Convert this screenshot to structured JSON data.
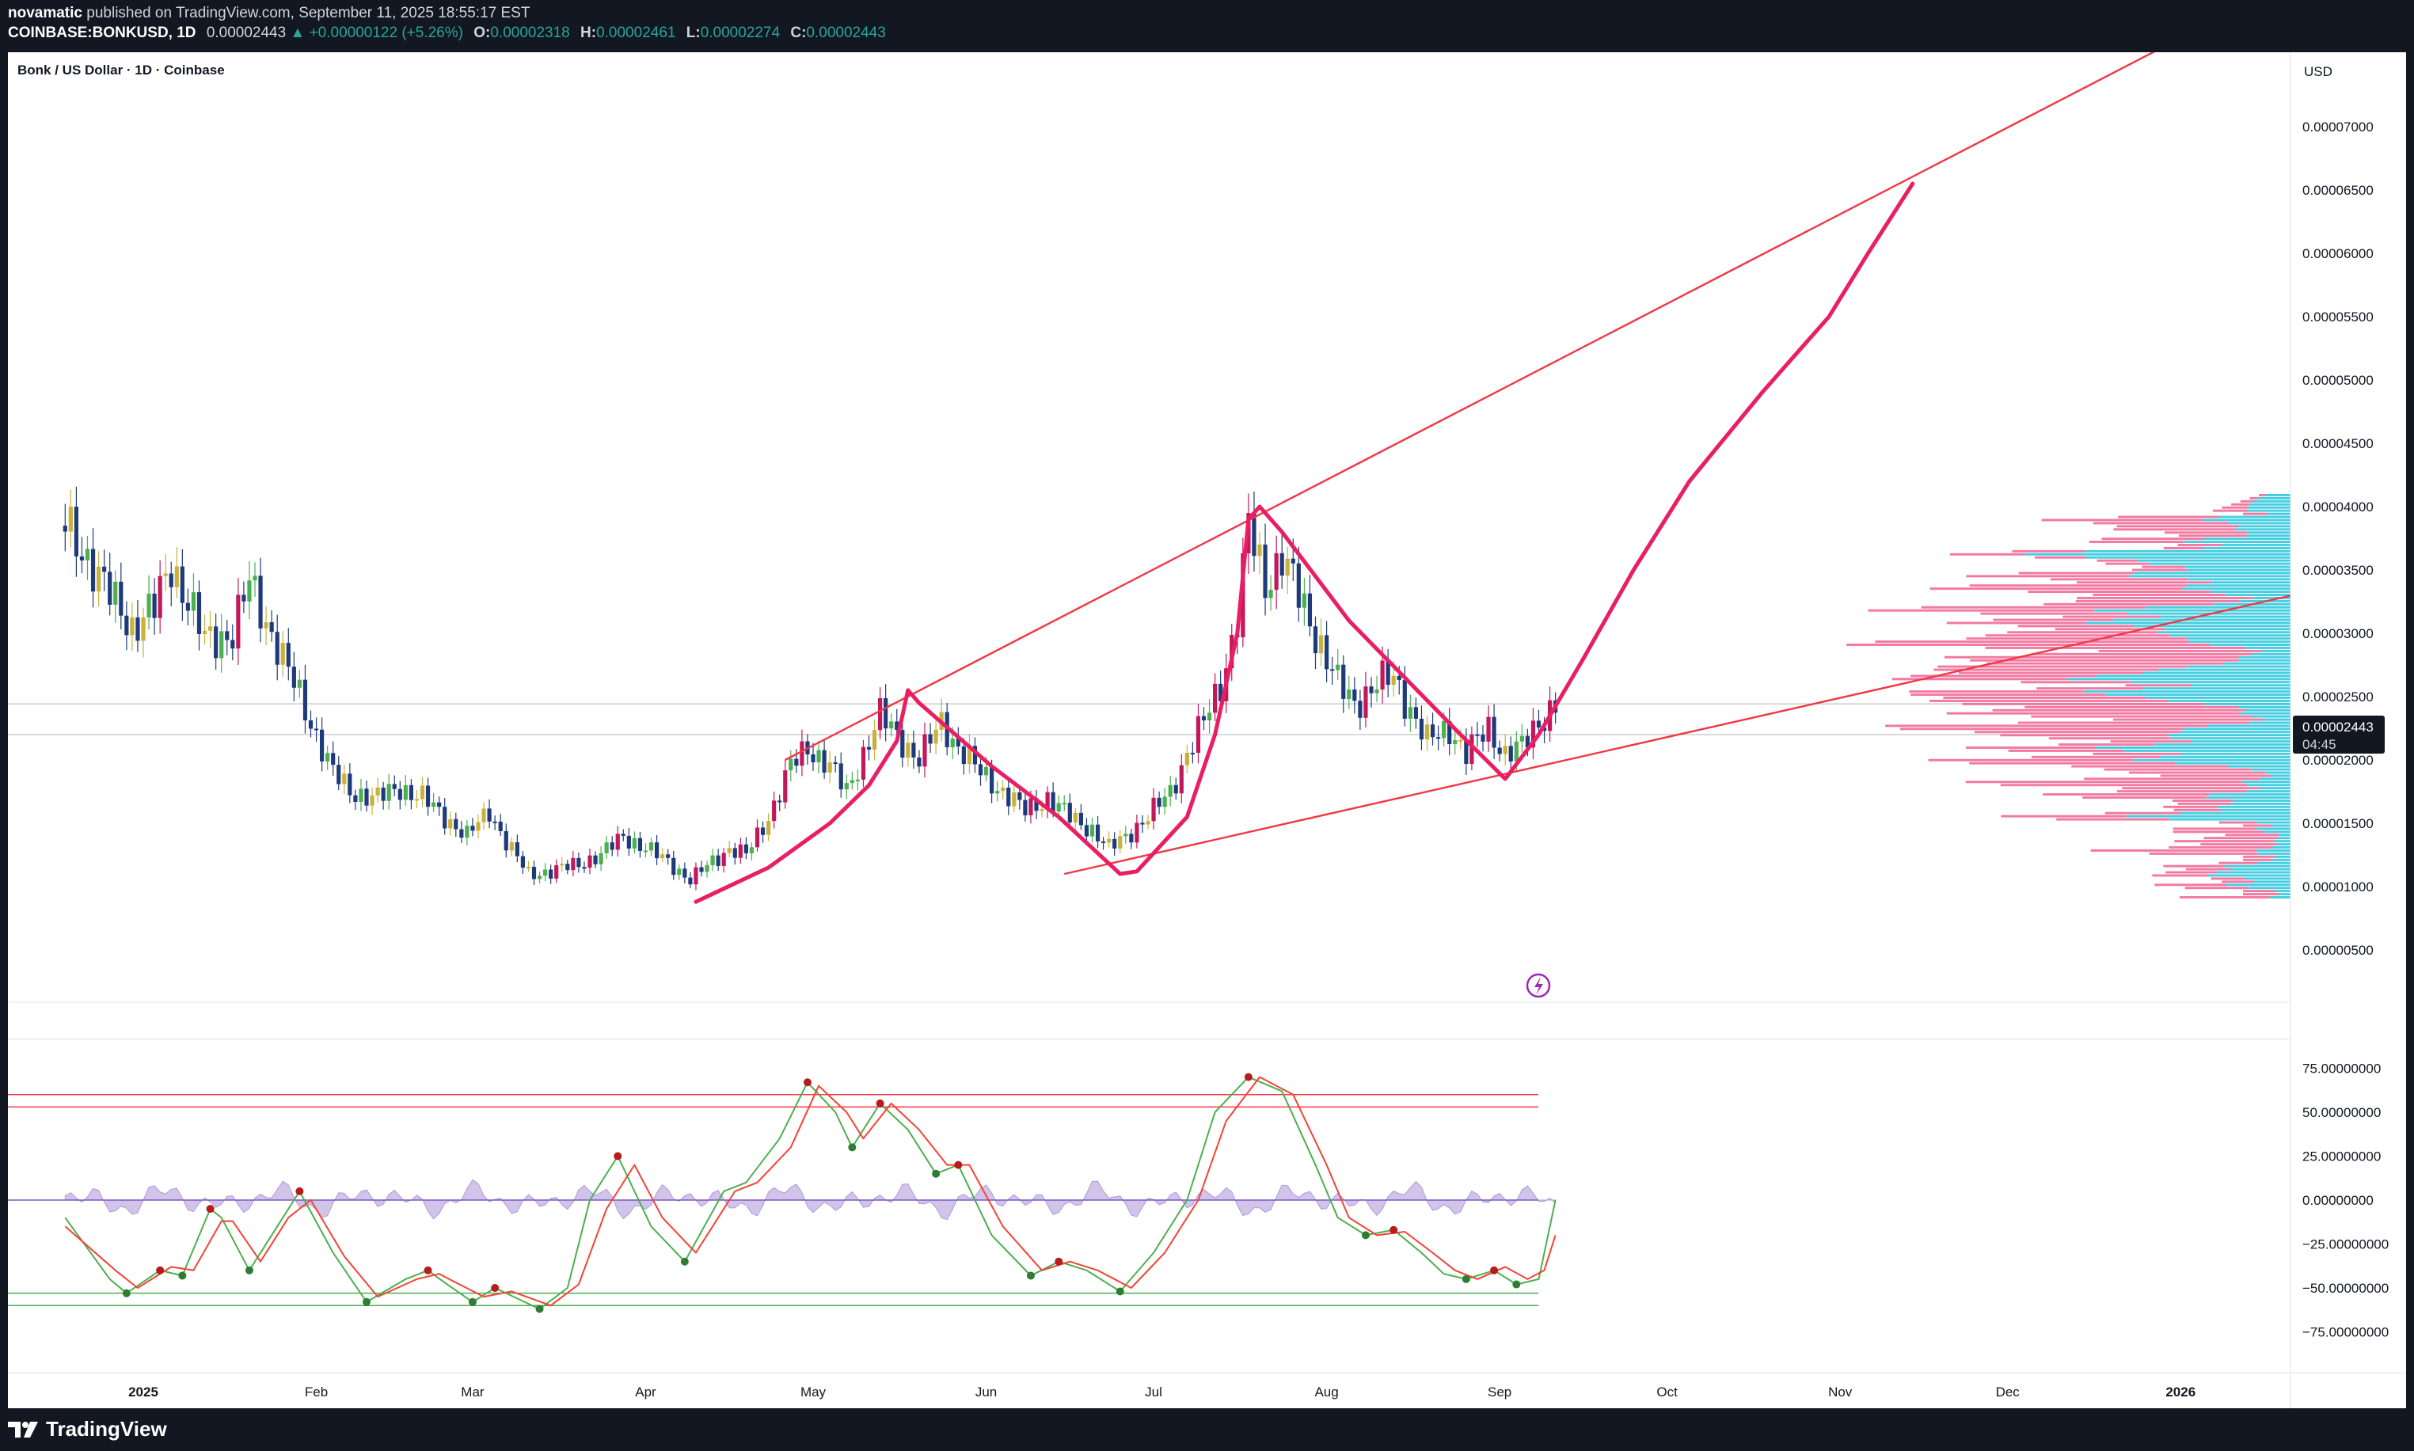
{
  "header": {
    "publisher": "novamatic",
    "published_text": "published on TradingView.com, September 11, 2025 18:55:17 EST",
    "symbol": "COINBASE:BONKUSD, 1D",
    "last": "0.00002443",
    "change": "▲ +0.00000122 (+5.26%)",
    "o_label": "O:",
    "o": "0.00002318",
    "h_label": "H:",
    "h": "0.00002461",
    "l_label": "L:",
    "l": "0.00002274",
    "c_label": "C:",
    "c": "0.00002443"
  },
  "chart": {
    "title": "Bonk / US Dollar · 1D · Coinbase",
    "currency": "USD",
    "price_tag": "0.00002443",
    "countdown": "04:45"
  },
  "colors": {
    "bull": "#4caf50",
    "bear": "#1e3a7b",
    "neutral": "#c9b13a",
    "hot": "#c2185b",
    "drawing": "#e91e63",
    "trendline": "#f23645",
    "vp_up": "#26c6da",
    "vp_down": "#f06292",
    "osc_fast": "#4caf50",
    "osc_slow": "#f44336",
    "histogram": "#b39ddb"
  },
  "footer": {
    "logo_text": "TradingView"
  },
  "chart_data": [
    {
      "type": "candlestick",
      "title": "Bonk / US Dollar · 1D · Coinbase",
      "y_unit": "USD",
      "x_ticks": [
        "2025",
        "Feb",
        "Mar",
        "Apr",
        "May",
        "Jun",
        "Jul",
        "Aug",
        "Sep",
        "Oct",
        "Nov",
        "Dec",
        "2026"
      ],
      "y_ticks": [
        "0.00007000",
        "0.00006500",
        "0.00006000",
        "0.00005500",
        "0.00005000",
        "0.00004500",
        "0.00004000",
        "0.00003500",
        "0.00003000",
        "0.00002500",
        "0.00002000",
        "0.00001500",
        "0.00001000",
        "0.00000500"
      ],
      "last_price": "0.00002443",
      "price_path": [
        {
          "date": "2024-12-18",
          "close": 3.85e-05
        },
        {
          "date": "2024-12-22",
          "close": 3.6e-05
        },
        {
          "date": "2024-12-26",
          "close": 3.3e-05
        },
        {
          "date": "2024-12-30",
          "close": 3.05e-05
        },
        {
          "date": "2025-01-03",
          "close": 3.2e-05
        },
        {
          "date": "2025-01-06",
          "close": 3.55e-05
        },
        {
          "date": "2025-01-09",
          "close": 3.25e-05
        },
        {
          "date": "2025-01-12",
          "close": 2.95e-05
        },
        {
          "date": "2025-01-17",
          "close": 3e-05
        },
        {
          "date": "2025-01-20",
          "close": 3.4e-05
        },
        {
          "date": "2025-01-24",
          "close": 3e-05
        },
        {
          "date": "2025-01-28",
          "close": 2.6e-05
        },
        {
          "date": "2025-01-31",
          "close": 2.3e-05
        },
        {
          "date": "2025-02-04",
          "close": 1.9e-05
        },
        {
          "date": "2025-02-07",
          "close": 1.75e-05
        },
        {
          "date": "2025-02-12",
          "close": 1.7e-05
        },
        {
          "date": "2025-02-16",
          "close": 1.78e-05
        },
        {
          "date": "2025-02-20",
          "close": 1.7e-05
        },
        {
          "date": "2025-02-24",
          "close": 1.55e-05
        },
        {
          "date": "2025-02-28",
          "close": 1.4e-05
        },
        {
          "date": "2025-03-04",
          "close": 1.6e-05
        },
        {
          "date": "2025-03-07",
          "close": 1.35e-05
        },
        {
          "date": "2025-03-11",
          "close": 1.1e-05
        },
        {
          "date": "2025-03-15",
          "close": 1.12e-05
        },
        {
          "date": "2025-03-20",
          "close": 1.18e-05
        },
        {
          "date": "2025-03-24",
          "close": 1.25e-05
        },
        {
          "date": "2025-03-28",
          "close": 1.4e-05
        },
        {
          "date": "2025-04-01",
          "close": 1.3e-05
        },
        {
          "date": "2025-04-05",
          "close": 1.2e-05
        },
        {
          "date": "2025-04-09",
          "close": 1.05e-05
        },
        {
          "date": "2025-04-13",
          "close": 1.2e-05
        },
        {
          "date": "2025-04-16",
          "close": 1.3e-05
        },
        {
          "date": "2025-04-19",
          "close": 1.25e-05
        },
        {
          "date": "2025-04-23",
          "close": 1.55e-05
        },
        {
          "date": "2025-04-27",
          "close": 1.95e-05
        },
        {
          "date": "2025-04-30",
          "close": 2.1e-05
        },
        {
          "date": "2025-05-04",
          "close": 1.95e-05
        },
        {
          "date": "2025-05-07",
          "close": 1.75e-05
        },
        {
          "date": "2025-05-10",
          "close": 2.05e-05
        },
        {
          "date": "2025-05-13",
          "close": 2.35e-05
        },
        {
          "date": "2025-05-16",
          "close": 2.2e-05
        },
        {
          "date": "2025-05-20",
          "close": 2e-05
        },
        {
          "date": "2025-05-24",
          "close": 2.3e-05
        },
        {
          "date": "2025-05-27",
          "close": 2.1e-05
        },
        {
          "date": "2025-05-31",
          "close": 1.9e-05
        },
        {
          "date": "2025-06-04",
          "close": 1.75e-05
        },
        {
          "date": "2025-06-08",
          "close": 1.6e-05
        },
        {
          "date": "2025-06-12",
          "close": 1.7e-05
        },
        {
          "date": "2025-06-16",
          "close": 1.55e-05
        },
        {
          "date": "2025-06-20",
          "close": 1.45e-05
        },
        {
          "date": "2025-06-23",
          "close": 1.3e-05
        },
        {
          "date": "2025-06-26",
          "close": 1.4e-05
        },
        {
          "date": "2025-06-30",
          "close": 1.55e-05
        },
        {
          "date": "2025-07-04",
          "close": 1.75e-05
        },
        {
          "date": "2025-07-07",
          "close": 2.05e-05
        },
        {
          "date": "2025-07-10",
          "close": 2.3e-05
        },
        {
          "date": "2025-07-13",
          "close": 2.6e-05
        },
        {
          "date": "2025-07-16",
          "close": 3.1e-05
        },
        {
          "date": "2025-07-18",
          "close": 3.85e-05
        },
        {
          "date": "2025-07-21",
          "close": 3.4e-05
        },
        {
          "date": "2025-07-24",
          "close": 3.6e-05
        },
        {
          "date": "2025-07-27",
          "close": 3.3e-05
        },
        {
          "date": "2025-07-30",
          "close": 3e-05
        },
        {
          "date": "2025-08-03",
          "close": 2.6e-05
        },
        {
          "date": "2025-08-06",
          "close": 2.45e-05
        },
        {
          "date": "2025-08-10",
          "close": 2.6e-05
        },
        {
          "date": "2025-08-13",
          "close": 2.65e-05
        },
        {
          "date": "2025-08-16",
          "close": 2.4e-05
        },
        {
          "date": "2025-08-19",
          "close": 2.15e-05
        },
        {
          "date": "2025-08-23",
          "close": 2.25e-05
        },
        {
          "date": "2025-08-26",
          "close": 2.05e-05
        },
        {
          "date": "2025-08-30",
          "close": 2.25e-05
        },
        {
          "date": "2025-09-02",
          "close": 2.05e-05
        },
        {
          "date": "2025-09-05",
          "close": 2.1e-05
        },
        {
          "date": "2025-09-08",
          "close": 2.3e-05
        },
        {
          "date": "2025-09-11",
          "close": 2.443e-05
        }
      ],
      "projection_path": [
        {
          "date": "2025-09-08",
          "price": 2.2e-05
        },
        {
          "date": "2025-09-16",
          "price": 2.8e-05
        },
        {
          "date": "2025-09-25",
          "price": 3.5e-05
        },
        {
          "date": "2025-10-05",
          "price": 4.2e-05
        },
        {
          "date": "2025-10-18",
          "price": 4.9e-05
        },
        {
          "date": "2025-10-30",
          "price": 5.5e-05
        },
        {
          "date": "2025-11-06",
          "price": 6e-05
        },
        {
          "date": "2025-11-14",
          "price": 6.55e-05
        }
      ],
      "trendlines": [
        {
          "from": {
            "date": "2025-04-26",
            "price": 2e-05
          },
          "to": {
            "date": "2026-01-01",
            "price": 7.7e-05
          }
        },
        {
          "from": {
            "date": "2025-06-15",
            "price": 1.1e-05
          },
          "to": {
            "date": "2026-01-31",
            "price": 3.4e-05
          }
        }
      ],
      "volume_profile_range": [
        9e-06,
        4.1e-05
      ]
    },
    {
      "type": "line",
      "x_ticks": [
        "2025",
        "Feb",
        "Mar",
        "Apr",
        "May",
        "Jun",
        "Jul",
        "Aug",
        "Sep",
        "Oct",
        "Nov",
        "Dec",
        "2026"
      ],
      "y_ticks": [
        "75.00000000",
        "50.00000000",
        "25.00000000",
        "0.00000000",
        "−25.00000000",
        "−50.00000000",
        "−75.00000000"
      ],
      "levels": [
        60,
        53,
        -53,
        -60
      ],
      "series": [
        {
          "points": [
            {
              "date": "2024-12-18",
              "value": -10
            },
            {
              "date": "2024-12-26",
              "value": -45
            },
            {
              "date": "2024-12-29",
              "value": -53
            },
            {
              "date": "2025-01-04",
              "value": -40
            },
            {
              "date": "2025-01-08",
              "value": -43
            },
            {
              "date": "2025-01-13",
              "value": -5
            },
            {
              "date": "2025-01-15",
              "value": -10
            },
            {
              "date": "2025-01-20",
              "value": -40
            },
            {
              "date": "2025-01-25",
              "value": -15
            },
            {
              "date": "2025-01-29",
              "value": 5
            },
            {
              "date": "2025-02-04",
              "value": -30
            },
            {
              "date": "2025-02-10",
              "value": -58
            },
            {
              "date": "2025-02-17",
              "value": -45
            },
            {
              "date": "2025-02-21",
              "value": -40
            },
            {
              "date": "2025-02-24",
              "value": -47
            },
            {
              "date": "2025-03-01",
              "value": -58
            },
            {
              "date": "2025-03-05",
              "value": -50
            },
            {
              "date": "2025-03-13",
              "value": -62
            },
            {
              "date": "2025-03-18",
              "value": -50
            },
            {
              "date": "2025-03-22",
              "value": 0
            },
            {
              "date": "2025-03-27",
              "value": 25
            },
            {
              "date": "2025-04-02",
              "value": -15
            },
            {
              "date": "2025-04-08",
              "value": -35
            },
            {
              "date": "2025-04-15",
              "value": 5
            },
            {
              "date": "2025-04-19",
              "value": 10
            },
            {
              "date": "2025-04-25",
              "value": 35
            },
            {
              "date": "2025-04-30",
              "value": 67
            },
            {
              "date": "2025-05-05",
              "value": 50
            },
            {
              "date": "2025-05-08",
              "value": 30
            },
            {
              "date": "2025-05-13",
              "value": 55
            },
            {
              "date": "2025-05-18",
              "value": 40
            },
            {
              "date": "2025-05-23",
              "value": 15
            },
            {
              "date": "2025-05-27",
              "value": 20
            },
            {
              "date": "2025-06-02",
              "value": -20
            },
            {
              "date": "2025-06-09",
              "value": -43
            },
            {
              "date": "2025-06-14",
              "value": -35
            },
            {
              "date": "2025-06-19",
              "value": -40
            },
            {
              "date": "2025-06-25",
              "value": -52
            },
            {
              "date": "2025-07-01",
              "value": -30
            },
            {
              "date": "2025-07-07",
              "value": 0
            },
            {
              "date": "2025-07-12",
              "value": 50
            },
            {
              "date": "2025-07-18",
              "value": 70
            },
            {
              "date": "2025-07-24",
              "value": 62
            },
            {
              "date": "2025-07-30",
              "value": 20
            },
            {
              "date": "2025-08-03",
              "value": -10
            },
            {
              "date": "2025-08-08",
              "value": -20
            },
            {
              "date": "2025-08-13",
              "value": -17
            },
            {
              "date": "2025-08-18",
              "value": -30
            },
            {
              "date": "2025-08-22",
              "value": -42
            },
            {
              "date": "2025-08-26",
              "value": -45
            },
            {
              "date": "2025-08-31",
              "value": -40
            },
            {
              "date": "2025-09-04",
              "value": -48
            },
            {
              "date": "2025-09-08",
              "value": -45
            },
            {
              "date": "2025-09-11",
              "value": 0
            }
          ]
        },
        {
          "points": [
            {
              "date": "2024-12-18",
              "value": -15
            },
            {
              "date": "2024-12-27",
              "value": -40
            },
            {
              "date": "2024-12-31",
              "value": -50
            },
            {
              "date": "2025-01-06",
              "value": -38
            },
            {
              "date": "2025-01-10",
              "value": -40
            },
            {
              "date": "2025-01-15",
              "value": -12
            },
            {
              "date": "2025-01-17",
              "value": -12
            },
            {
              "date": "2025-01-22",
              "value": -35
            },
            {
              "date": "2025-01-27",
              "value": -10
            },
            {
              "date": "2025-01-31",
              "value": 0
            },
            {
              "date": "2025-02-06",
              "value": -32
            },
            {
              "date": "2025-02-12",
              "value": -55
            },
            {
              "date": "2025-02-19",
              "value": -45
            },
            {
              "date": "2025-02-23",
              "value": -42
            },
            {
              "date": "2025-02-26",
              "value": -47
            },
            {
              "date": "2025-03-03",
              "value": -55
            },
            {
              "date": "2025-03-08",
              "value": -52
            },
            {
              "date": "2025-03-15",
              "value": -60
            },
            {
              "date": "2025-03-20",
              "value": -48
            },
            {
              "date": "2025-03-25",
              "value": -5
            },
            {
              "date": "2025-03-30",
              "value": 20
            },
            {
              "date": "2025-04-04",
              "value": -10
            },
            {
              "date": "2025-04-10",
              "value": -30
            },
            {
              "date": "2025-04-17",
              "value": 5
            },
            {
              "date": "2025-04-21",
              "value": 10
            },
            {
              "date": "2025-04-27",
              "value": 30
            },
            {
              "date": "2025-05-02",
              "value": 65
            },
            {
              "date": "2025-05-07",
              "value": 50
            },
            {
              "date": "2025-05-10",
              "value": 35
            },
            {
              "date": "2025-05-15",
              "value": 55
            },
            {
              "date": "2025-05-20",
              "value": 40
            },
            {
              "date": "2025-05-25",
              "value": 20
            },
            {
              "date": "2025-05-29",
              "value": 20
            },
            {
              "date": "2025-06-04",
              "value": -15
            },
            {
              "date": "2025-06-11",
              "value": -40
            },
            {
              "date": "2025-06-16",
              "value": -35
            },
            {
              "date": "2025-06-21",
              "value": -40
            },
            {
              "date": "2025-06-27",
              "value": -50
            },
            {
              "date": "2025-07-03",
              "value": -30
            },
            {
              "date": "2025-07-09",
              "value": 0
            },
            {
              "date": "2025-07-14",
              "value": 45
            },
            {
              "date": "2025-07-20",
              "value": 70
            },
            {
              "date": "2025-07-26",
              "value": 60
            },
            {
              "date": "2025-08-01",
              "value": 20
            },
            {
              "date": "2025-08-05",
              "value": -10
            },
            {
              "date": "2025-08-10",
              "value": -20
            },
            {
              "date": "2025-08-15",
              "value": -18
            },
            {
              "date": "2025-08-20",
              "value": -30
            },
            {
              "date": "2025-08-24",
              "value": -40
            },
            {
              "date": "2025-08-28",
              "value": -45
            },
            {
              "date": "2025-09-02",
              "value": -38
            },
            {
              "date": "2025-09-06",
              "value": -45
            },
            {
              "date": "2025-09-09",
              "value": -40
            },
            {
              "date": "2025-09-11",
              "value": -20
            }
          ]
        }
      ]
    }
  ]
}
